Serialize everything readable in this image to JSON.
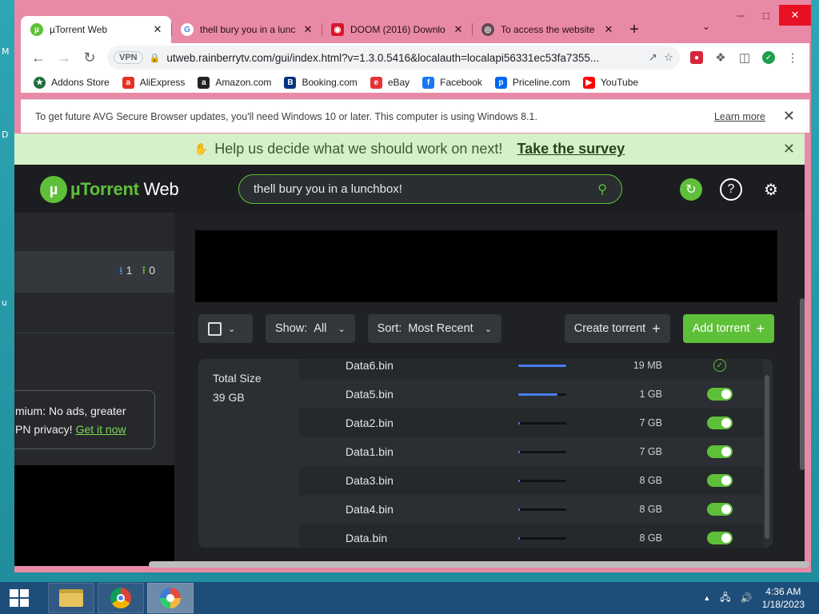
{
  "desktop": {
    "left_letters": [
      "M",
      "D",
      "u"
    ]
  },
  "tabs": [
    {
      "label": "µTorrent Web",
      "icon": "utorrent-icon",
      "active": true
    },
    {
      "label": "thell bury you in a lunc",
      "icon": "google-icon",
      "active": false
    },
    {
      "label": "DOOM (2016) Downlo",
      "icon": "ghost-icon",
      "active": false
    },
    {
      "label": "To access the website c",
      "icon": "globe-icon",
      "active": false
    }
  ],
  "toolbar": {
    "vpn_label": "VPN",
    "url": "utweb.rainberrytv.com/gui/index.html?v=1.3.0.5416&localauth=localapi56331ec53fa7355..."
  },
  "bookmarks": [
    {
      "label": "Addons Store",
      "color": "#1e6e3c"
    },
    {
      "label": "AliExpress",
      "color": "#e43225"
    },
    {
      "label": "Amazon.com",
      "color": "#222222"
    },
    {
      "label": "Booking.com",
      "color": "#003580"
    },
    {
      "label": "eBay",
      "color": "#e53238"
    },
    {
      "label": "Facebook",
      "color": "#1877f2"
    },
    {
      "label": "Priceline.com",
      "color": "#0068ef"
    },
    {
      "label": "YouTube",
      "color": "#ff0000"
    }
  ],
  "infobar": {
    "message": "To get future AVG Secure Browser updates, you'll need Windows 10 or later. This computer is using Windows 8.1.",
    "learn_more": "Learn more"
  },
  "survey": {
    "text": "Help us decide what we should work on next!",
    "link": "Take the survey"
  },
  "app": {
    "logo_mu": "µ",
    "logo_torrent": "Torrent",
    "logo_web": " Web",
    "search_value": "thell bury you in a lunchbox!",
    "accent": "#5ec039"
  },
  "sidebar": {
    "downloading_count": "1",
    "uploading_count": "0",
    "premium_line1": "mium: No ads, greater",
    "premium_line2": "PN privacy!",
    "premium_link": "Get it now"
  },
  "controls": {
    "show_label": "Show:",
    "show_value": "All",
    "sort_label": "Sort:",
    "sort_value": "Most Recent",
    "create_label": "Create torrent",
    "add_label": "Add torrent"
  },
  "files_panel": {
    "total_label": "Total Size",
    "total_value": "39 GB",
    "files": [
      {
        "name": "Data6.bin",
        "progress": 1.0,
        "size": "19 MB",
        "complete": true
      },
      {
        "name": "Data5.bin",
        "progress": 0.82,
        "size": "1 GB",
        "complete": false
      },
      {
        "name": "Data2.bin",
        "progress": 0.03,
        "size": "7 GB",
        "complete": false
      },
      {
        "name": "Data1.bin",
        "progress": 0.03,
        "size": "7 GB",
        "complete": false
      },
      {
        "name": "Data3.bin",
        "progress": 0.03,
        "size": "8 GB",
        "complete": false
      },
      {
        "name": "Data4.bin",
        "progress": 0.03,
        "size": "8 GB",
        "complete": false
      },
      {
        "name": "Data.bin",
        "progress": 0.03,
        "size": "8 GB",
        "complete": false
      }
    ]
  },
  "taskbar": {
    "time": "4:36 AM",
    "date": "1/18/2023"
  }
}
